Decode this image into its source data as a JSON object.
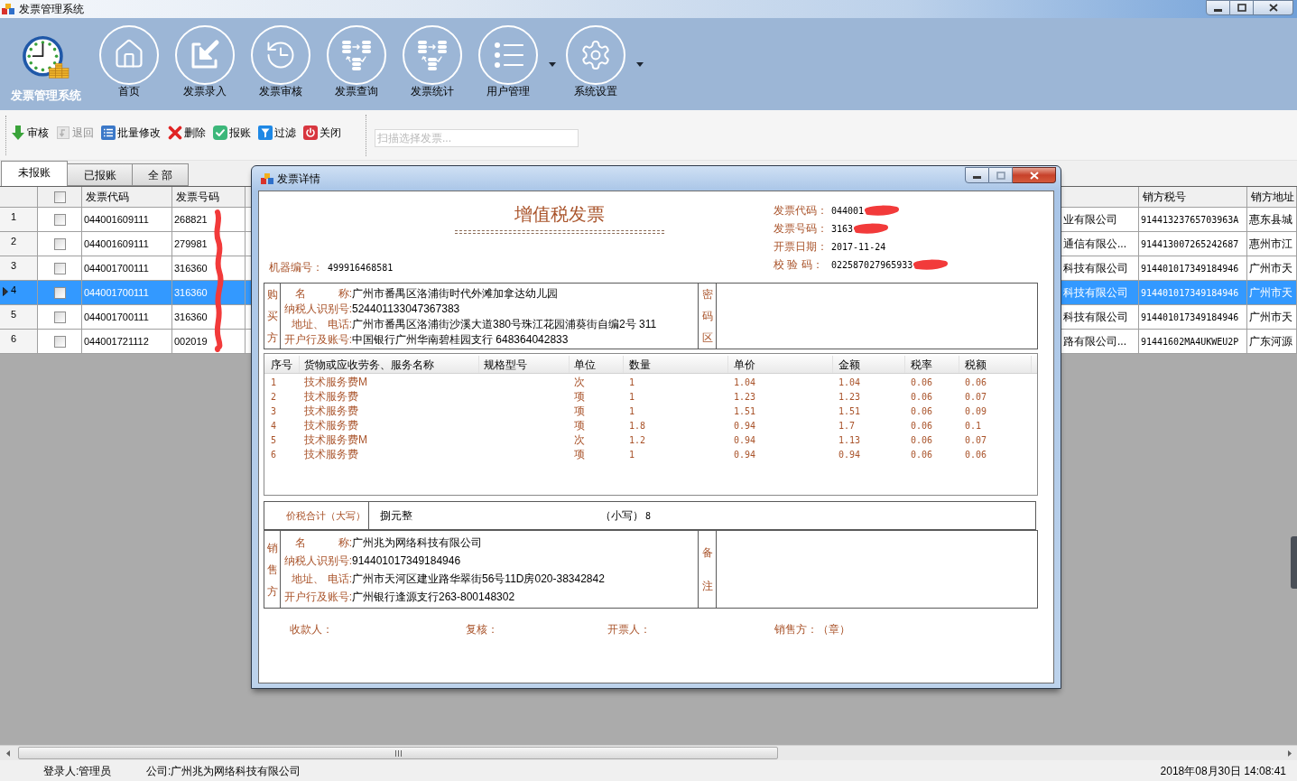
{
  "window": {
    "title": "发票管理系统"
  },
  "ribbon": {
    "logo_label": "发票管理系统",
    "items": [
      {
        "label": "首页",
        "dropdown": false
      },
      {
        "label": "发票录入",
        "dropdown": false
      },
      {
        "label": "发票审核",
        "dropdown": false
      },
      {
        "label": "发票查询",
        "dropdown": false
      },
      {
        "label": "发票统计",
        "dropdown": false
      },
      {
        "label": "用户管理",
        "dropdown": true
      },
      {
        "label": "系统设置",
        "dropdown": true
      }
    ]
  },
  "toolbar": {
    "buttons": [
      {
        "label": "审核",
        "disabled": false
      },
      {
        "label": "退回",
        "disabled": true
      },
      {
        "label": "批量修改",
        "disabled": false
      },
      {
        "label": "删除",
        "disabled": false
      },
      {
        "label": "报账",
        "disabled": false
      },
      {
        "label": "过滤",
        "disabled": false
      },
      {
        "label": "关闭",
        "disabled": false
      }
    ],
    "scan_field": {
      "placeholder": "扫描选择发票..."
    }
  },
  "tabs": [
    {
      "label": "未报账",
      "selected": true
    },
    {
      "label": "已报账",
      "selected": false
    },
    {
      "label": "全 部",
      "selected": false
    }
  ],
  "invoice_table": {
    "header_checkbox": {
      "checked": false
    },
    "columns": [
      "发票代码",
      "发票号码",
      "销方税号",
      "销方地址"
    ],
    "rows": [
      {
        "number": "1",
        "selected": false,
        "checked": false,
        "invoice_code": "044001609111",
        "invoice_number": "268821",
        "partial_column": "业有限公司",
        "seller_tax_id": "91441323765703963A",
        "seller_address": "惠东县城"
      },
      {
        "number": "2",
        "selected": false,
        "checked": false,
        "invoice_code": "044001609111",
        "invoice_number": "279981",
        "partial_column": "通信有限公...",
        "seller_tax_id": "914413007265242687",
        "seller_address": "惠州市江"
      },
      {
        "number": "3",
        "selected": false,
        "checked": false,
        "invoice_code": "044001700111",
        "invoice_number": "316360",
        "partial_column": "科技有限公司",
        "seller_tax_id": "914401017349184946",
        "seller_address": "广州市天"
      },
      {
        "number": "4",
        "selected": true,
        "checked": false,
        "invoice_code": "044001700111",
        "invoice_number": "316360",
        "partial_column": "科技有限公司",
        "seller_tax_id": "914401017349184946",
        "seller_address": "广州市天"
      },
      {
        "number": "5",
        "selected": false,
        "checked": false,
        "invoice_code": "044001700111",
        "invoice_number": "316360",
        "partial_column": "科技有限公司",
        "seller_tax_id": "914401017349184946",
        "seller_address": "广州市天"
      },
      {
        "number": "6",
        "selected": false,
        "checked": false,
        "invoice_code": "044001721112",
        "invoice_number": "002019",
        "partial_column": "路有限公司...",
        "seller_tax_id": "91441602MA4UKWEU2P",
        "seller_address": "广东河源"
      }
    ]
  },
  "invoice_dialog": {
    "title": "发票详情",
    "invoice_title": "增值税发票",
    "header_fields": [
      {
        "label": "发票代码：",
        "value": "044001"
      },
      {
        "label": "发票号码：",
        "value": "3163"
      },
      {
        "label": "开票日期：",
        "value": "2017-11-24"
      },
      {
        "label": "校 验 码：",
        "value": "022587027965933"
      }
    ],
    "machine_number": {
      "label": "机器编号：",
      "value": "499916468581"
    },
    "buyer": {
      "side_label": "购买方",
      "fields": [
        {
          "label": "名　　　称:",
          "value": "广州市番禺区洛浦街时代外滩加拿达幼儿园"
        },
        {
          "label": "纳税人识别号:",
          "value": "524401133047367383"
        },
        {
          "label": "地址、 电话:",
          "value": "广州市番禺区洛浦街沙溪大道380号珠江花园浦葵街自编2号 311"
        },
        {
          "label": "开户行及账号:",
          "value": "中国银行广州华南碧桂园支行 648364042833"
        }
      ],
      "cipher_label": "密码区"
    },
    "items": {
      "columns": [
        "序号",
        "货物或应收劳务、服务名称",
        "规格型号",
        "单位",
        "数量",
        "单价",
        "金额",
        "税率",
        "税额"
      ],
      "rows": [
        {
          "no": "1",
          "name": "技术服务费M",
          "unit": "次",
          "qty": "1",
          "price": "1.04",
          "amount": "1.04",
          "rate": "0.06",
          "tax": "0.06"
        },
        {
          "no": "2",
          "name": "技术服务费",
          "unit": "项",
          "qty": "1",
          "price": "1.23",
          "amount": "1.23",
          "rate": "0.06",
          "tax": "0.07"
        },
        {
          "no": "3",
          "name": "技术服务费",
          "unit": "项",
          "qty": "1",
          "price": "1.51",
          "amount": "1.51",
          "rate": "0.06",
          "tax": "0.09"
        },
        {
          "no": "4",
          "name": "技术服务费",
          "unit": "项",
          "qty": "1.8",
          "price": "0.94",
          "amount": "1.7",
          "rate": "0.06",
          "tax": "0.1"
        },
        {
          "no": "5",
          "name": "技术服务费M",
          "unit": "次",
          "qty": "1.2",
          "price": "0.94",
          "amount": "1.13",
          "rate": "0.06",
          "tax": "0.07"
        },
        {
          "no": "6",
          "name": "技术服务费",
          "unit": "项",
          "qty": "1",
          "price": "0.94",
          "amount": "0.94",
          "rate": "0.06",
          "tax": "0.06"
        }
      ]
    },
    "total": {
      "label": "价税合计（大写）",
      "words": "捌元整",
      "small_label": "（小写）",
      "small_value": "8"
    },
    "seller": {
      "side_label": "销售方",
      "fields": [
        {
          "label": "名　　　称:",
          "value": "广州兆为网络科技有限公司"
        },
        {
          "label": "纳税人识别号:",
          "value": "914401017349184946"
        },
        {
          "label": "地址、 电话:",
          "value": "广州市天河区建业路华翠街56号11D房020-38342842"
        },
        {
          "label": "开户行及账号:",
          "value": "广州银行逢源支行263-800148302"
        }
      ],
      "remarks_label": "备注"
    },
    "signatures": [
      "收款人：",
      "复核：",
      "开票人：",
      "销售方：（章）"
    ]
  },
  "status_bar": {
    "user": "登录人:管理员",
    "company": "公司:广州兆为网络科技有限公司",
    "datetime": "2018年08月30日 14:08:41"
  }
}
